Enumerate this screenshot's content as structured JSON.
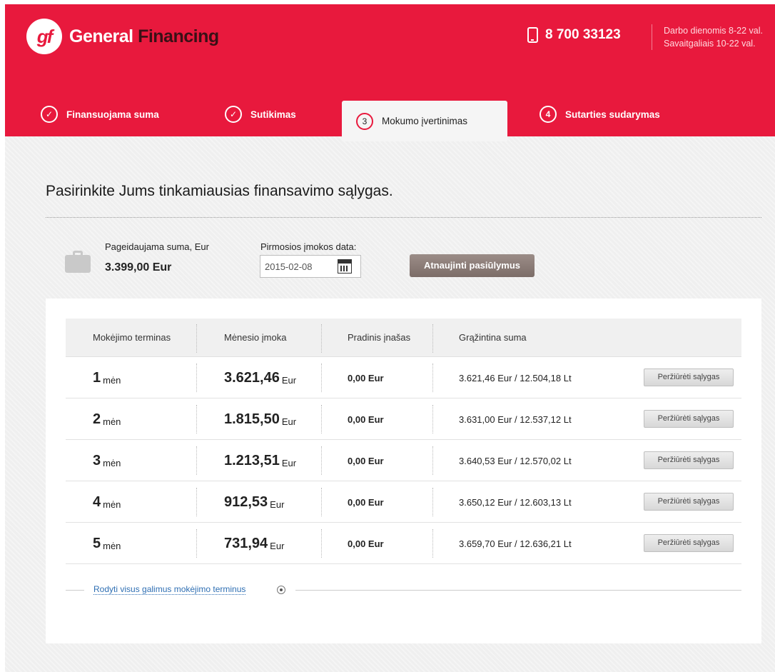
{
  "header": {
    "logo_mark": "gf",
    "brand_first": "General",
    "brand_second": "Financing",
    "phone": "8 700 33123",
    "hours_weekdays": "Darbo dienomis 8-22 val.",
    "hours_weekend": "Savaitgaliais 10-22 val."
  },
  "steps": [
    {
      "marker": "✓",
      "label": "Finansuojama suma",
      "state": "done"
    },
    {
      "marker": "✓",
      "label": "Sutikimas",
      "state": "done"
    },
    {
      "marker": "3",
      "label": "Mokumo įvertinimas",
      "state": "active"
    },
    {
      "marker": "4",
      "label": "Sutarties sudarymas",
      "state": "pending"
    }
  ],
  "page_title": "Pasirinkite Jums tinkamiausias finansavimo sąlygas.",
  "summary": {
    "amount_label": "Pageidaujama suma, Eur",
    "amount_value": "3.399,00 Eur",
    "date_label": "Pirmosios įmokos data:",
    "date_value": "2015-02-08",
    "refresh_button": "Atnaujinti pasiūlymus"
  },
  "table": {
    "headers": [
      "Mokėjimo terminas",
      "Mėnesio įmoka",
      "Pradinis įnašas",
      "Grąžintina suma"
    ],
    "rows": [
      {
        "term": "1",
        "term_unit": "mėn",
        "monthly": "3.621,46",
        "monthly_unit": "Eur",
        "initial": "0,00 Eur",
        "total": "3.621,46 Eur / 12.504,18 Lt",
        "button": "Peržiūrėti sąlygas"
      },
      {
        "term": "2",
        "term_unit": "mėn",
        "monthly": "1.815,50",
        "monthly_unit": "Eur",
        "initial": "0,00 Eur",
        "total": "3.631,00 Eur / 12.537,12 Lt",
        "button": "Peržiūrėti sąlygas"
      },
      {
        "term": "3",
        "term_unit": "mėn",
        "monthly": "1.213,51",
        "monthly_unit": "Eur",
        "initial": "0,00 Eur",
        "total": "3.640,53 Eur / 12.570,02 Lt",
        "button": "Peržiūrėti sąlygas"
      },
      {
        "term": "4",
        "term_unit": "mėn",
        "monthly": "912,53",
        "monthly_unit": "Eur",
        "initial": "0,00 Eur",
        "total": "3.650,12 Eur / 12.603,13 Lt",
        "button": "Peržiūrėti sąlygas"
      },
      {
        "term": "5",
        "term_unit": "mėn",
        "monthly": "731,94",
        "monthly_unit": "Eur",
        "initial": "0,00 Eur",
        "total": "3.659,70 Eur / 12.636,21 Lt",
        "button": "Peržiūrėti sąlygas"
      }
    ]
  },
  "show_all_link": "Rodyti visus galimus mokėjimo terminus",
  "icons": {
    "phone": "phone-icon",
    "briefcase": "briefcase-icon",
    "calendar": "calendar-icon",
    "expand": "expand-circle-icon",
    "check": "check-icon"
  },
  "colors": {
    "brand_red": "#e8193d",
    "link_blue": "#2f6fb3",
    "button_brown": "#8c7d78"
  }
}
